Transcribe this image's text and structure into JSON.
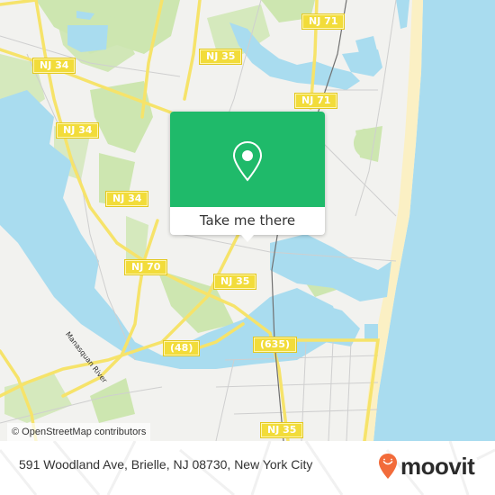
{
  "map": {
    "colors": {
      "land": "#f2f2ef",
      "water": "#a9dcef",
      "park": "#cde6b0",
      "beach": "#fbf0c4",
      "road_major": "#f6e36a",
      "road_minor": "#cfcfcf",
      "rail": "#707070"
    },
    "shields": [
      {
        "label": "NJ 34"
      },
      {
        "label": "NJ 34"
      },
      {
        "label": "NJ 34"
      },
      {
        "label": "NJ 35"
      },
      {
        "label": "NJ 71"
      },
      {
        "label": "NJ 71"
      },
      {
        "label": "NJ 70"
      },
      {
        "label": "NJ 35"
      },
      {
        "label": "(48)"
      },
      {
        "label": "(635)"
      },
      {
        "label": "NJ 35"
      }
    ],
    "river_label": "Manasquan River",
    "attribution": "© OpenStreetMap contributors"
  },
  "popup": {
    "icon": "map-pin-icon",
    "accent_color": "#1fba6a",
    "button_label": "Take me there"
  },
  "footer": {
    "address": "591 Woodland Ave, Brielle, NJ 08730, New York City",
    "brand": "moovit",
    "brand_color": "#f26b3a"
  }
}
